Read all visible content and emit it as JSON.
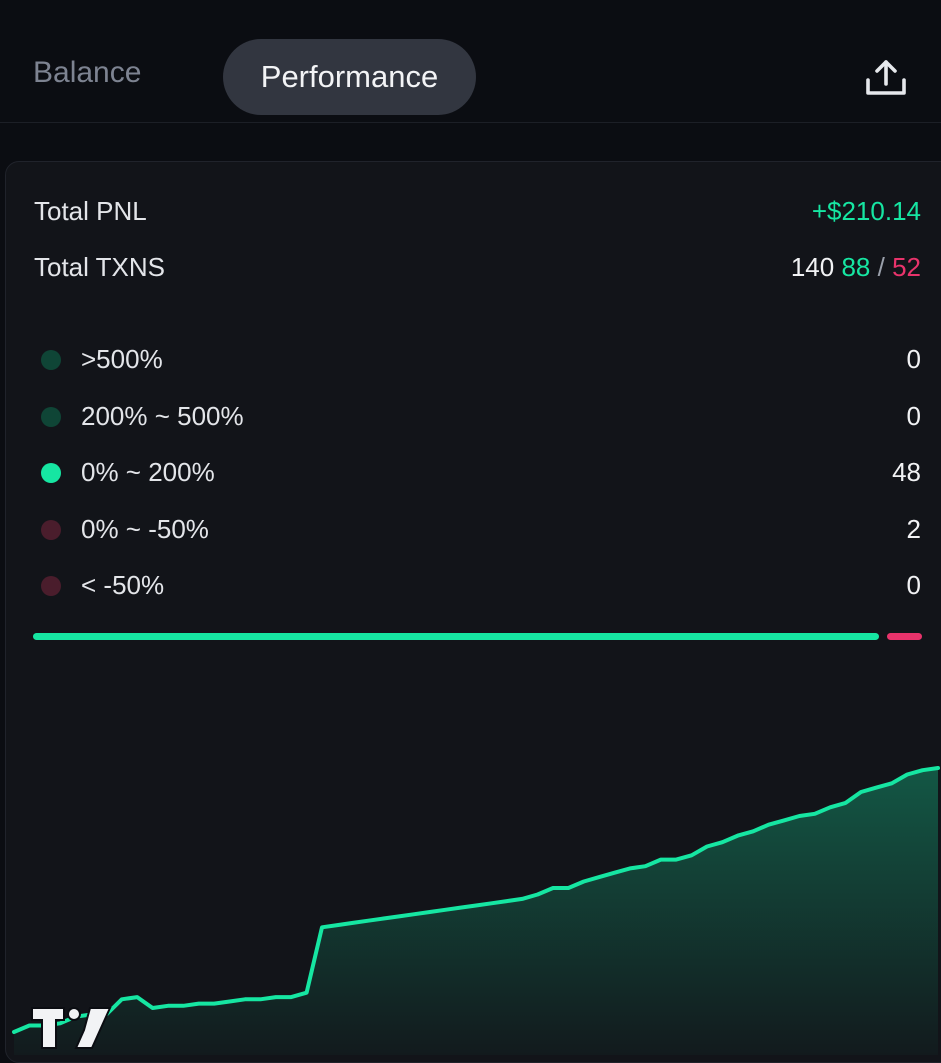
{
  "tabs": {
    "balance": "Balance",
    "performance": "Performance",
    "active": "performance"
  },
  "header": {
    "share_icon": "share-upload-icon"
  },
  "summary": {
    "total_pnl_label": "Total PNL",
    "total_pnl_value": "+$210.14",
    "total_txns_label": "Total TXNS",
    "total_txns_count": "140",
    "wins": "88",
    "separator": "/",
    "losses": "52"
  },
  "buckets": [
    {
      "label": ">500%",
      "value": "0",
      "color": "#0f4536"
    },
    {
      "label": "200% ~ 500%",
      "value": "0",
      "color": "#0f4536"
    },
    {
      "label": "0% ~ 200%",
      "value": "48",
      "color": "#16e6a2"
    },
    {
      "label": "0% ~ -50%",
      "value": "2",
      "color": "#4a1d2c"
    },
    {
      "label": "< -50%",
      "value": "0",
      "color": "#4a1d2c"
    }
  ],
  "distribution": {
    "positive_fraction": 0.96,
    "negative_fraction": 0.04
  },
  "colors": {
    "background": "#0b0d12",
    "card": "#121419",
    "accent_green": "#16e6a2",
    "accent_pink": "#e8336b",
    "tab_active": "#323640"
  },
  "chart_data": {
    "type": "area",
    "title": "",
    "xlabel": "",
    "ylabel": "",
    "grid": false,
    "y": [
      0,
      3,
      3,
      4,
      7,
      8,
      8,
      15,
      16,
      11,
      12,
      12,
      13,
      13,
      14,
      15,
      15,
      16,
      16,
      18,
      48,
      49,
      50,
      51,
      52,
      53,
      54,
      55,
      56,
      57,
      58,
      59,
      60,
      61,
      63,
      66,
      66,
      69,
      71,
      73,
      75,
      76,
      79,
      79,
      81,
      85,
      87,
      90,
      92,
      95,
      97,
      99,
      100,
      103,
      105,
      110,
      112,
      114,
      118,
      120,
      121
    ]
  },
  "logo": {
    "name": "tradingview-logo",
    "text": "TV"
  }
}
